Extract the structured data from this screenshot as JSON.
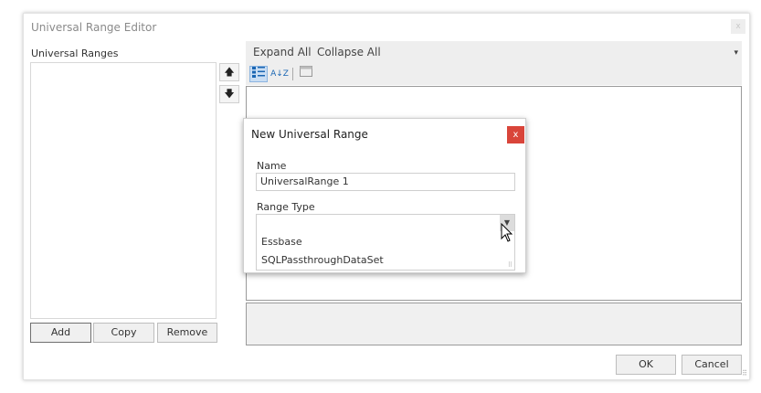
{
  "window": {
    "title": "Universal Range Editor",
    "close_glyph": "x"
  },
  "left_panel": {
    "label": "Universal Ranges",
    "move_up_glyph": "🡅",
    "move_down_glyph": "🡇",
    "buttons": {
      "add": "Add",
      "copy": "Copy",
      "remove": "Remove"
    }
  },
  "toolbar": {
    "expand_all": "Expand All",
    "collapse_all": "Collapse All",
    "menu_glyph": "▾",
    "categorized_icon": "categorized-icon",
    "sort_az_icon": "sort-az-icon",
    "property_pages_icon": "property-pages-icon",
    "sort_glyph": "A↓Z"
  },
  "footer": {
    "ok": "OK",
    "cancel": "Cancel",
    "grip": "⠿"
  },
  "dialog": {
    "title": "New Universal Range",
    "close_glyph": "x",
    "name_label": "Name",
    "name_value": "UniversalRange 1",
    "range_type_label": "Range Type",
    "range_type_value": "",
    "combo_arrow": "▼",
    "options": [
      "Essbase",
      "SQLPassthroughDataSet"
    ],
    "grip": "⠿"
  },
  "colors": {
    "close_red": "#d9453a",
    "toolbar_bg": "#eeeeee",
    "active_icon_bg": "#c9ddf3"
  }
}
